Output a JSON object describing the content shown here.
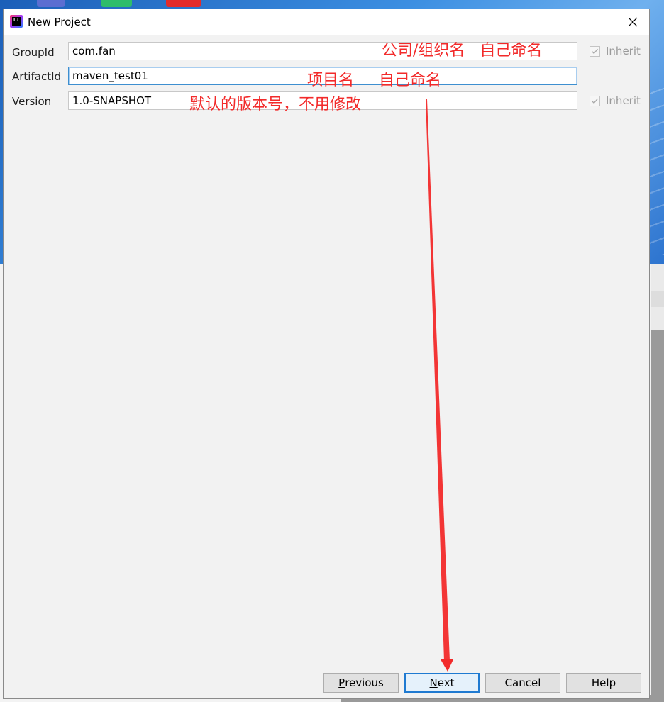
{
  "window": {
    "title": "New Project"
  },
  "form": {
    "group_id": {
      "label": "GroupId",
      "value": "com.fan",
      "inherit_label": "Inherit",
      "inherit_checked": true
    },
    "artifact_id": {
      "label": "ArtifactId",
      "value": "maven_test01"
    },
    "version": {
      "label": "Version",
      "value": "1.0-SNAPSHOT",
      "inherit_label": "Inherit",
      "inherit_checked": true
    }
  },
  "annotations": {
    "group_id_note": "公司/组织名   自己命名",
    "artifact_id_note": "项目名     自己命名",
    "version_note": "默认的版本号，不用修改"
  },
  "buttons": {
    "previous": {
      "mnemonic": "P",
      "rest": "revious"
    },
    "next": {
      "mnemonic": "N",
      "rest": "ext"
    },
    "cancel": "Cancel",
    "help": "Help"
  },
  "colors": {
    "annotation": "#f22a2a",
    "focus_border": "#3d8fd0",
    "default_button_border": "#1f7ad1"
  },
  "icons": {
    "app": "intellij-idea-icon",
    "close": "close-icon",
    "check": "checkmark-icon"
  }
}
